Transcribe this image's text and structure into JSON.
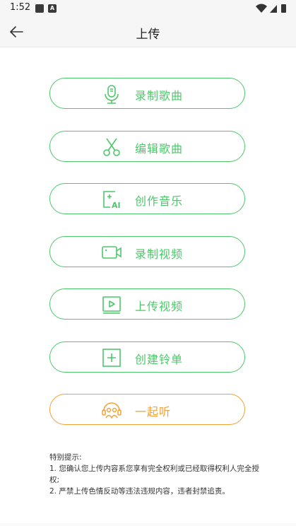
{
  "status_bar": {
    "time": "1:52"
  },
  "app_bar": {
    "title": "上传"
  },
  "buttons": [
    {
      "label": "录制歌曲",
      "icon": "microphone-icon"
    },
    {
      "label": "编辑歌曲",
      "icon": "scissors-icon"
    },
    {
      "label": "创作音乐",
      "icon": "ai-compose-icon"
    },
    {
      "label": "录制视频",
      "icon": "video-camera-icon"
    },
    {
      "label": "上传视频",
      "icon": "video-play-icon"
    },
    {
      "label": "创建铃单",
      "icon": "plus-box-icon"
    },
    {
      "label": "一起听",
      "icon": "listen-together-icon"
    }
  ],
  "notes": {
    "heading": "特别提示:",
    "line1": "1. 您确认您上传内容系您享有完全权利或已经取得权利人完全授权;",
    "line2": "2. 严禁上传色情反动等违法违规内容，违者封禁追责。"
  },
  "colors": {
    "accent_green": "#4cc86a",
    "accent_orange": "#f3a035"
  }
}
